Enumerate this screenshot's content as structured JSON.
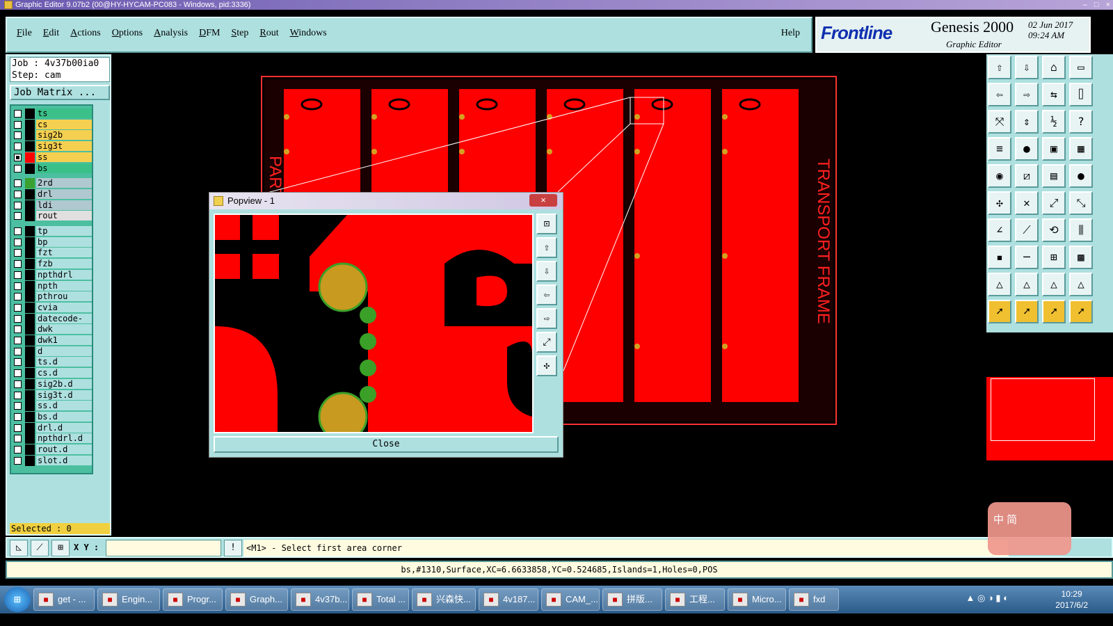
{
  "window": {
    "title": "Graphic Editor 9.07b2 (00@HY-HYCAM-PC083 - Windows, pid:3336)"
  },
  "menu": {
    "items": [
      "File",
      "Edit",
      "Actions",
      "Options",
      "Analysis",
      "DFM",
      "Step",
      "Rout",
      "Windows"
    ],
    "help": "Help"
  },
  "brand": {
    "logo": "Frontline",
    "product": "Genesis 2000",
    "subtitle": "Graphic Editor",
    "date": "02 Jun 2017",
    "time": "09:24 AM"
  },
  "job": {
    "name_line": "Job : 4v37b00ia0",
    "step_line": "Step: cam",
    "matrix_button": "Job Matrix ..."
  },
  "layers": [
    {
      "name": "ts",
      "style": "on",
      "checked": false,
      "swatch": "#000"
    },
    {
      "name": "cs",
      "style": "y",
      "checked": false,
      "swatch": "#000"
    },
    {
      "name": "sig2b",
      "style": "y",
      "checked": false,
      "swatch": "#000"
    },
    {
      "name": "sig3t",
      "style": "y",
      "checked": false,
      "swatch": "#000"
    },
    {
      "name": "ss",
      "style": "y",
      "checked": true,
      "swatch": "#ff0000"
    },
    {
      "name": "bs",
      "style": "on",
      "checked": false,
      "swatch": "#000"
    },
    {
      "name": "2rd",
      "style": "b",
      "checked": false,
      "swatch": "#3aa030"
    },
    {
      "name": "drl",
      "style": "b",
      "checked": false,
      "swatch": "#000"
    },
    {
      "name": "ldi",
      "style": "b",
      "checked": false,
      "swatch": "#000"
    },
    {
      "name": "rout",
      "style": "w",
      "checked": false,
      "swatch": "#000"
    },
    {
      "name": "tp",
      "style": "",
      "checked": false,
      "swatch": "#000"
    },
    {
      "name": "bp",
      "style": "",
      "checked": false,
      "swatch": "#000"
    },
    {
      "name": "fzt",
      "style": "",
      "checked": false,
      "swatch": "#000"
    },
    {
      "name": "fzb",
      "style": "",
      "checked": false,
      "swatch": "#000"
    },
    {
      "name": "npthdrl",
      "style": "",
      "checked": false,
      "swatch": "#000"
    },
    {
      "name": "npth",
      "style": "",
      "checked": false,
      "swatch": "#000"
    },
    {
      "name": "pthrou",
      "style": "",
      "checked": false,
      "swatch": "#000"
    },
    {
      "name": "cvia",
      "style": "",
      "checked": false,
      "swatch": "#000"
    },
    {
      "name": "datecode-bs",
      "style": "",
      "checked": false,
      "swatch": "#000"
    },
    {
      "name": "dwk",
      "style": "",
      "checked": false,
      "swatch": "#000"
    },
    {
      "name": "dwk1",
      "style": "",
      "checked": false,
      "swatch": "#000"
    },
    {
      "name": "d",
      "style": "",
      "checked": false,
      "swatch": "#000"
    },
    {
      "name": "ts.d",
      "style": "",
      "checked": false,
      "swatch": "#000"
    },
    {
      "name": "cs.d",
      "style": "",
      "checked": false,
      "swatch": "#000"
    },
    {
      "name": "sig2b.d",
      "style": "",
      "checked": false,
      "swatch": "#000"
    },
    {
      "name": "sig3t.d",
      "style": "",
      "checked": false,
      "swatch": "#000"
    },
    {
      "name": "ss.d",
      "style": "",
      "checked": false,
      "swatch": "#000"
    },
    {
      "name": "bs.d",
      "style": "",
      "checked": false,
      "swatch": "#000"
    },
    {
      "name": "drl.d",
      "style": "",
      "checked": false,
      "swatch": "#000"
    },
    {
      "name": "npthdrl.d",
      "style": "",
      "checked": false,
      "swatch": "#000"
    },
    {
      "name": "rout.d",
      "style": "",
      "checked": false,
      "swatch": "#000"
    },
    {
      "name": "slot.d",
      "style": "",
      "checked": false,
      "swatch": "#000"
    }
  ],
  "selected": "Selected : 0",
  "coords": {
    "label": "X Y :",
    "value": ""
  },
  "prompt": "<M1> - Select first area corner",
  "status": "bs,#1310,Surface,XC=6.6633858,YC=0.524685,Islands=1,Holes=0,POS",
  "popview": {
    "title": "Popview - 1",
    "close_x": "×",
    "close_button": "Close"
  },
  "panel_texts": {
    "left": "PART",
    "right": "TRANSPORT FRAME"
  },
  "ime": {
    "text": "中 简"
  },
  "taskbar": {
    "items": [
      "get - ...",
      "Engin...",
      "Progr...",
      "Graph...",
      "4v37b...",
      "Total ...",
      "兴森快...",
      "4v187...",
      "CAM_...",
      "拼版...",
      "工程...",
      "Micro...",
      "fxd"
    ],
    "time": "10:29",
    "date": "2017/6/2"
  },
  "colors": {
    "copper": "#ff0000",
    "pad": "#d4a020",
    "bg": "#000000",
    "ui": "#aee0e0"
  }
}
